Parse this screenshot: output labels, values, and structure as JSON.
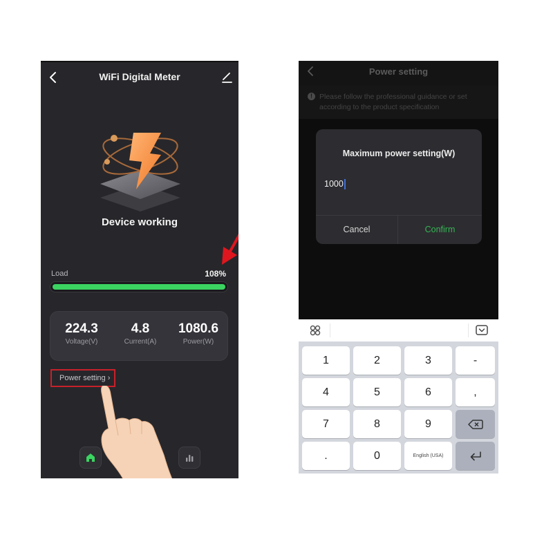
{
  "left_screen": {
    "header": {
      "title": "WiFi Digital Meter",
      "back_icon": "chevron-left-icon",
      "edit_icon": "pencil-icon"
    },
    "status": {
      "illustration": "lightning-bolt-atom-icon",
      "text": "Device working"
    },
    "load": {
      "label": "Load",
      "value_text": "108%",
      "fill_fraction": 1.0,
      "bar_color": "#3bd461"
    },
    "stats": [
      {
        "value": "224.3",
        "label": "Voltage(V)"
      },
      {
        "value": "4.8",
        "label": "Current(A)"
      },
      {
        "value": "1080.6",
        "label": "Power(W)"
      }
    ],
    "power_setting_link": {
      "label": "Power setting",
      "chevron": "›",
      "highlight_color": "#c8202a"
    },
    "tab_bar": [
      {
        "name": "home",
        "icon": "home-icon",
        "active": true,
        "color": "#3bd461"
      },
      {
        "name": "statistics",
        "icon": "bar-chart-icon",
        "active": false,
        "color": "#9a9aa0"
      }
    ],
    "annotations": {
      "arrow_icon": "red-arrow-icon",
      "arrow_color": "#e0161e",
      "hand_icon": "pointing-hand-icon"
    }
  },
  "right_screen": {
    "header": {
      "title": "Power setting",
      "back_icon": "chevron-left-icon"
    },
    "notice": {
      "icon": "info-icon",
      "icon_glyph": "!",
      "text": "Please follow the professional guidance or set according to the product specification"
    },
    "dialog": {
      "title": "Maximum power setting(W)",
      "input_value": "1000",
      "cancel_label": "Cancel",
      "confirm_label": "Confirm",
      "confirm_color": "#35b454"
    },
    "keyboard_toolbar": {
      "left_icon": "apps-grid-icon",
      "right_icon": "keyboard-hide-icon"
    },
    "keyboard": {
      "rows": [
        [
          "1",
          "2",
          "3",
          "-"
        ],
        [
          "4",
          "5",
          "6",
          ","
        ],
        [
          "7",
          "8",
          "9",
          "backspace"
        ],
        [
          ".",
          "0",
          "English (USA)",
          "enter"
        ]
      ],
      "keys": {
        "k1": "1",
        "k2": "2",
        "k3": "3",
        "kdash": "-",
        "k4": "4",
        "k5": "5",
        "k6": "6",
        "kcomma": ",",
        "k7": "7",
        "k8": "8",
        "k9": "9",
        "kdot": ".",
        "k0": "0",
        "klang": "English (USA)"
      },
      "backspace_icon": "backspace-icon",
      "enter_icon": "enter-icon"
    }
  }
}
